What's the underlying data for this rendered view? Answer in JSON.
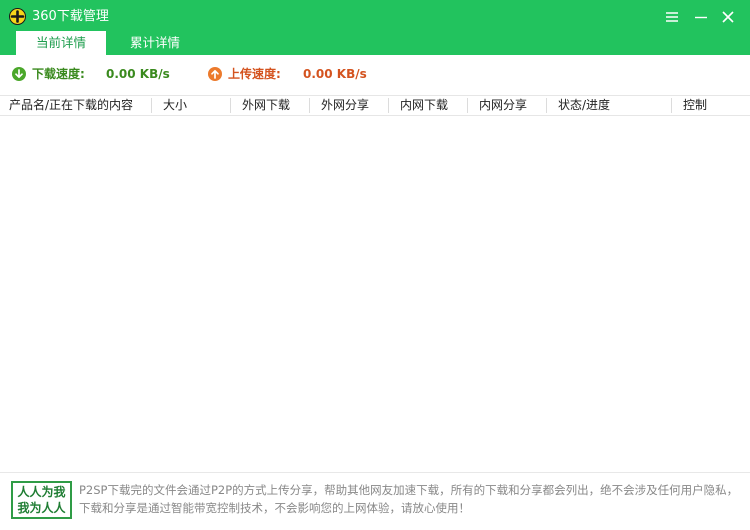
{
  "window": {
    "title": "360下载管理",
    "menu_icon": "hamburger-icon",
    "minimize_icon": "minimize-icon",
    "close_icon": "close-icon"
  },
  "tabs": [
    {
      "label": "当前详情",
      "active": true
    },
    {
      "label": "累计详情",
      "active": false
    }
  ],
  "speed": {
    "download_label": "下载速度:",
    "download_value": "0.00 KB/s",
    "upload_label": "上传速度:",
    "upload_value": "0.00 KB/s"
  },
  "table": {
    "columns": [
      "产品名/正在下载的内容",
      "大小",
      "外网下载",
      "外网分享",
      "内网下载",
      "内网分享",
      "状态/进度",
      "控制"
    ]
  },
  "footer": {
    "badge_line1": "人人为我",
    "badge_line2": "我为人人",
    "notice": "P2SP下载完的文件会通过P2P的方式上传分享，帮助其他网友加速下载，所有的下载和分享都会列出，绝不会涉及任何用户隐私，下载和分享是通过智能带宽控制技术，不会影响您的上网体验，请放心使用！"
  },
  "colors": {
    "brand_green": "#22c35e",
    "download_green": "#3a8a1e",
    "upload_orange": "#e0622a"
  }
}
